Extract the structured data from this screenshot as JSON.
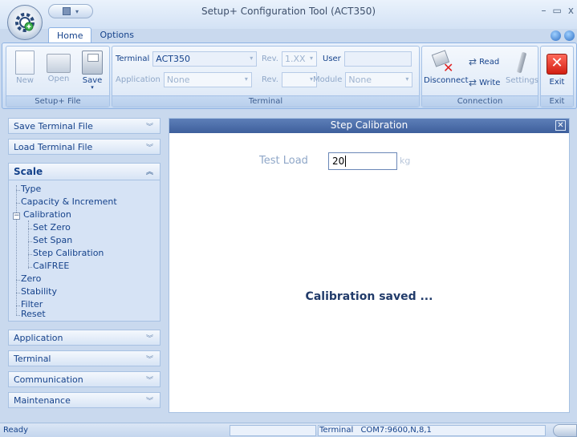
{
  "window": {
    "title": "Setup+ Configuration Tool (ACT350)",
    "controls": [
      "–",
      "▭",
      "x"
    ]
  },
  "tabs": [
    {
      "label": "Home",
      "active": true
    },
    {
      "label": "Options",
      "active": false
    }
  ],
  "ribbon": {
    "setup_file": {
      "group_label": "Setup+ File",
      "new_label": "New",
      "open_label": "Open",
      "save_label": "Save"
    },
    "terminal": {
      "group_label": "Terminal",
      "terminal_label": "Terminal",
      "terminal_value": "ACT350",
      "application_label": "Application",
      "application_value": "None",
      "rev_label_1": "Rev.",
      "rev_value_1": "1.XX",
      "rev_label_2": "Rev.",
      "rev_value_2": "",
      "user_label": "User",
      "user_value": "",
      "module_label": "Module",
      "module_value": "None"
    },
    "connection": {
      "group_label": "Connection",
      "disconnect_label": "Disconnect",
      "read_label": "Read",
      "write_label": "Write",
      "settings_label": "Settings"
    },
    "exit": {
      "group_label": "Exit",
      "exit_label": "Exit"
    }
  },
  "sidebar": {
    "sections": [
      {
        "label": "Save Terminal File"
      },
      {
        "label": "Load Terminal File"
      },
      {
        "label": "Scale"
      },
      {
        "label": "Application"
      },
      {
        "label": "Terminal"
      },
      {
        "label": "Communication"
      },
      {
        "label": "Maintenance"
      }
    ],
    "scale_tree": {
      "type": "Type",
      "capacity": "Capacity & Increment",
      "calibration": "Calibration",
      "set_zero": "Set Zero",
      "set_span": "Set Span",
      "step_calibration": "Step Calibration",
      "calfree": "CalFREE",
      "zero": "Zero",
      "stability": "Stability",
      "filter": "Filter",
      "reset": "Reset"
    }
  },
  "main": {
    "title": "Step Calibration",
    "test_load_label": "Test Load",
    "test_load_value": "20",
    "unit": "kg",
    "message": "Calibration saved ..."
  },
  "status": {
    "ready": "Ready",
    "terminal_label": "Terminal",
    "port": "COM7:9600,N,8,1"
  }
}
